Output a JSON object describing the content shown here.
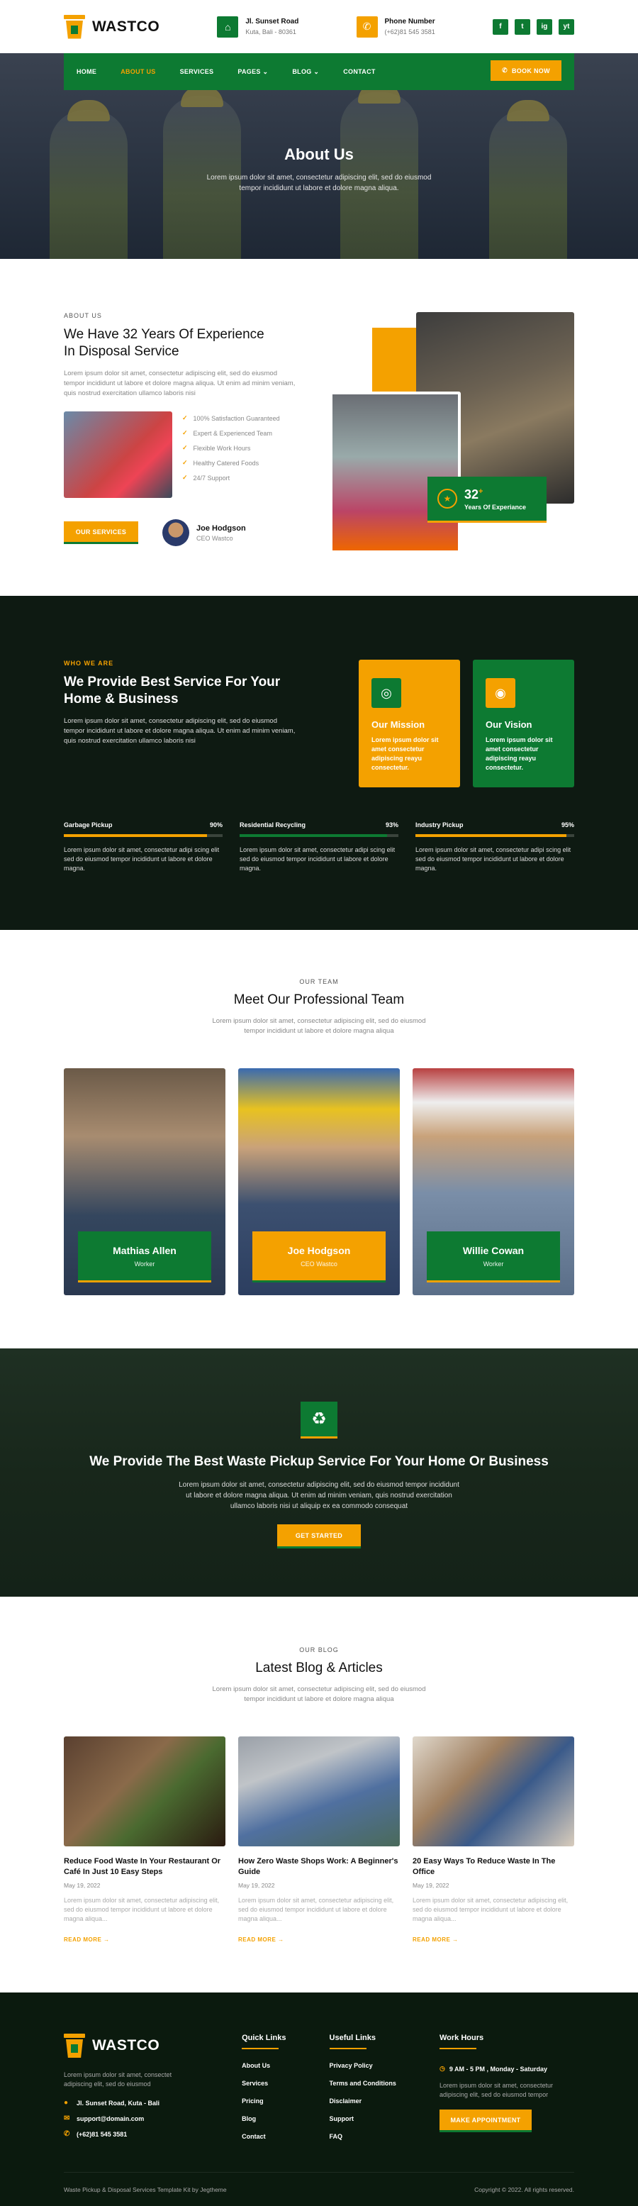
{
  "brand": {
    "name": "WASTCO"
  },
  "header": {
    "address_title": "Jl. Sunset Road",
    "address_sub": "Kuta, Bali - 80361",
    "phone_title": "Phone Number",
    "phone_sub": "(+62)81 545 3581",
    "socials": [
      "f",
      "t",
      "ig",
      "yt"
    ]
  },
  "nav": {
    "items": [
      "HOME",
      "ABOUT US",
      "SERVICES",
      "PAGES",
      "BLOG",
      "CONTACT"
    ],
    "active": "ABOUT US",
    "cta": "BOOK NOW"
  },
  "hero": {
    "title": "About Us",
    "line1": "Lorem ipsum dolor sit amet, consectetur adipiscing elit, sed do eiusmod",
    "line2": "tempor incididunt ut labore et dolore magna aliqua."
  },
  "about": {
    "eyebrow": "ABOUT US",
    "title_line1": "We Have 32 Years Of Experience",
    "title_line2": "In Disposal Service",
    "para": "Lorem ipsum dolor sit amet, consectetur adipiscing elit, sed do eiusmod tempor incididunt ut labore et dolore magna aliqua. Ut enim ad minim veniam, quis nostrud exercitation ullamco laboris nisi",
    "checks": [
      "100% Satisfaction Guaranteed",
      "Expert & Experienced Team",
      "Flexible Work Hours",
      "Healthy Catered Foods",
      "24/7 Support"
    ],
    "button": "OUR SERVICES",
    "ceo_name": "Joe Hodgson",
    "ceo_role": "CEO Wastco",
    "badge_num": "32",
    "badge_plus": "+",
    "badge_label": "Years Of Experiance"
  },
  "service": {
    "eyebrow": "WHO WE ARE",
    "title_line1": "We Provide Best Service For Your",
    "title_line2": "Home & Business",
    "para": "Lorem ipsum dolor sit amet, consectetur adipiscing elit, sed do eiusmod tempor incididunt ut labore et dolore magna aliqua. Ut enim ad minim veniam, quis nostrud exercitation ullamco laboris nisi",
    "mission_title": "Our Mission",
    "mission_text": "Lorem ipsum dolor sit amet consectetur adipiscing reayu consectetur.",
    "vision_title": "Our Vision",
    "vision_text": "Lorem ipsum dolor sit amet consectetur adipiscing reayu consectetur.",
    "progress": [
      {
        "label": "Garbage Pickup",
        "percent": 90,
        "text": "90%",
        "color": "#f4a100",
        "para": "Lorem ipsum dolor sit amet, consectetur adipi scing elit sed do eiusmod tempor incididunt ut labore et dolore magna."
      },
      {
        "label": "Residential Recycling",
        "percent": 93,
        "text": "93%",
        "color": "#0d7a32",
        "para": "Lorem ipsum dolor sit amet, consectetur adipi scing elit sed do eiusmod tempor incididunt ut labore et dolore magna."
      },
      {
        "label": "Industry Pickup",
        "percent": 95,
        "text": "95%",
        "color": "#f4a100",
        "para": "Lorem ipsum dolor sit amet, consectetur adipi scing elit sed do eiusmod tempor incididunt ut labore et dolore magna."
      }
    ]
  },
  "team": {
    "eyebrow": "OUR TEAM",
    "title": "Meet Our Professional Team",
    "line1": "Lorem ipsum dolor sit amet, consectetur adipiscing elit, sed do eiusmod",
    "line2": "tempor incididunt ut labore et dolore magna aliqua",
    "members": [
      {
        "name": "Mathias Allen",
        "role": "Worker"
      },
      {
        "name": "Joe Hodgson",
        "role": "CEO Wastco"
      },
      {
        "name": "Willie Cowan",
        "role": "Worker"
      }
    ]
  },
  "cta": {
    "title": "We Provide The Best Waste Pickup Service For Your Home Or Business",
    "line1": "Lorem ipsum dolor sit amet, consectetur adipiscing elit, sed do eiusmod tempor incididunt",
    "line2": "ut labore et dolore magna aliqua. Ut enim ad minim veniam, quis nostrud exercitation",
    "line3": "ullamco laboris nisi ut aliquip ex ea commodo consequat",
    "button": "GET STARTED"
  },
  "blog": {
    "eyebrow": "OUR BLOG",
    "title": "Latest Blog & Articles",
    "line1": "Lorem ipsum dolor sit amet, consectetur adipiscing elit, sed do eiusmod",
    "line2": "tempor incididunt ut labore et dolore magna aliqua",
    "posts": [
      {
        "title": "Reduce Food Waste In Your Restaurant Or Café In Just 10 Easy Steps",
        "date": "May 19, 2022",
        "excerpt": "Lorem ipsum dolor sit amet, consectetur adipiscing elit, sed do eiusmod tempor incididunt ut labore et dolore magna aliqua...",
        "more": "READ MORE"
      },
      {
        "title": "How Zero Waste Shops Work: A Beginner's Guide",
        "date": "May 19, 2022",
        "excerpt": "Lorem ipsum dolor sit amet, consectetur adipiscing elit, sed do eiusmod tempor incididunt ut labore et dolore magna aliqua...",
        "more": "READ MORE"
      },
      {
        "title": "20 Easy Ways To Reduce Waste In The Office",
        "date": "May 19, 2022",
        "excerpt": "Lorem ipsum dolor sit amet, consectetur adipiscing elit, sed do eiusmod tempor incididunt ut labore et dolore magna aliqua...",
        "more": "READ MORE"
      }
    ]
  },
  "footer": {
    "about": "Lorem ipsum dolor sit amet, consectet adipiscing elit, sed do eiusmod",
    "address": "Jl. Sunset Road, Kuta - Bali",
    "email": "support@domain.com",
    "phone": "(+62)81 545 3581",
    "quick_title": "Quick Links",
    "quick_links": [
      "About Us",
      "Services",
      "Pricing",
      "Blog",
      "Contact"
    ],
    "useful_title": "Useful Links",
    "useful_links": [
      "Privacy Policy",
      "Terms and Conditions",
      "Disclaimer",
      "Support",
      "FAQ"
    ],
    "hours_title": "Work Hours",
    "hours": "9 AM - 5 PM , Monday - Saturday",
    "hours_para": "Lorem ipsum dolor sit amet, consectetur adipiscing elit, sed do eiusmod tempor",
    "button": "MAKE APPOINTMENT",
    "credit": "Waste Pickup & Disposal Services Template Kit by Jegtheme",
    "copyright": "Copyright © 2022. All rights reserved."
  },
  "colors": {
    "green": "#0d7a32",
    "orange": "#f4a100",
    "dark": "#0e1a12"
  }
}
